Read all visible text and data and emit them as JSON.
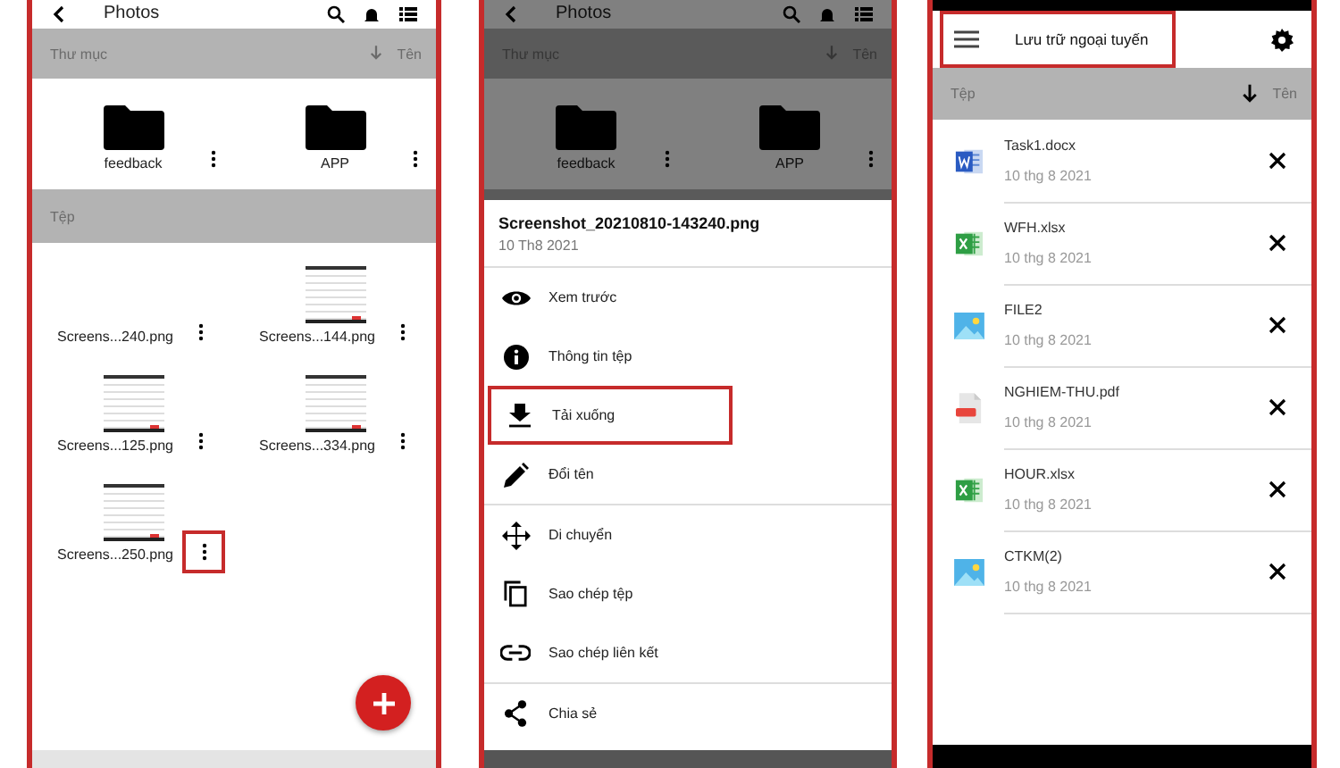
{
  "folder_screen": {
    "title": "Photos",
    "folders_header": {
      "label": "Thư mục",
      "sort": "Tên"
    },
    "folders": [
      {
        "name": "feedback"
      },
      {
        "name": "APP"
      }
    ],
    "files_header": {
      "label": "Tệp"
    },
    "files": [
      {
        "name": "Screens...240.png",
        "thumbnail": false,
        "highlighted": false
      },
      {
        "name": "Screens...144.png",
        "thumbnail": true,
        "highlighted": false
      },
      {
        "name": "Screens...125.png",
        "thumbnail": true,
        "highlighted": false
      },
      {
        "name": "Screens...334.png",
        "thumbnail": true,
        "highlighted": false
      },
      {
        "name": "Screens...250.png",
        "thumbnail": true,
        "highlighted": true
      }
    ]
  },
  "sheet_screen": {
    "dimmed": true,
    "title": "Photos",
    "folders_header": {
      "label": "Thư mục",
      "sort": "Tên"
    },
    "folders": [
      {
        "name": "feedback"
      },
      {
        "name": "APP"
      }
    ],
    "file": {
      "name": "Screenshot_20210810-143240.png",
      "date": "10 Th8 2021"
    },
    "actions": [
      {
        "kind": "preview",
        "label": "Xem trước",
        "highlighted": false,
        "divider": false
      },
      {
        "kind": "info",
        "label": "Thông tin tệp",
        "highlighted": false,
        "divider": false
      },
      {
        "kind": "download",
        "label": "Tải xuống",
        "highlighted": true,
        "divider": false
      },
      {
        "kind": "rename",
        "label": "Đổi tên",
        "highlighted": false,
        "divider": true
      },
      {
        "kind": "move",
        "label": "Di chuyển",
        "highlighted": false,
        "divider": false
      },
      {
        "kind": "copy",
        "label": "Sao chép tệp",
        "highlighted": false,
        "divider": false
      },
      {
        "kind": "link",
        "label": "Sao chép liên kết",
        "highlighted": false,
        "divider": true
      },
      {
        "kind": "share",
        "label": "Chia sẻ",
        "highlighted": false,
        "divider": false
      }
    ]
  },
  "offline_screen": {
    "title": "Lưu trữ ngoại tuyến",
    "title_highlighted": true,
    "header": {
      "label": "Tệp",
      "sort": "Tên"
    },
    "files": [
      {
        "kind": "word",
        "name": "Task1.docx",
        "date": "10 thg 8 2021"
      },
      {
        "kind": "excel",
        "name": "WFH.xlsx",
        "date": "10 thg 8 2021"
      },
      {
        "kind": "image",
        "name": "FILE2",
        "date": "10 thg 8 2021"
      },
      {
        "kind": "pdf",
        "name": "NGHIEM-THU.pdf",
        "date": "10 thg 8 2021"
      },
      {
        "kind": "excel",
        "name": "HOUR.xlsx",
        "date": "10 thg 8 2021"
      },
      {
        "kind": "image",
        "name": "CTKM(2)",
        "date": "10 thg 8 2021"
      }
    ]
  }
}
